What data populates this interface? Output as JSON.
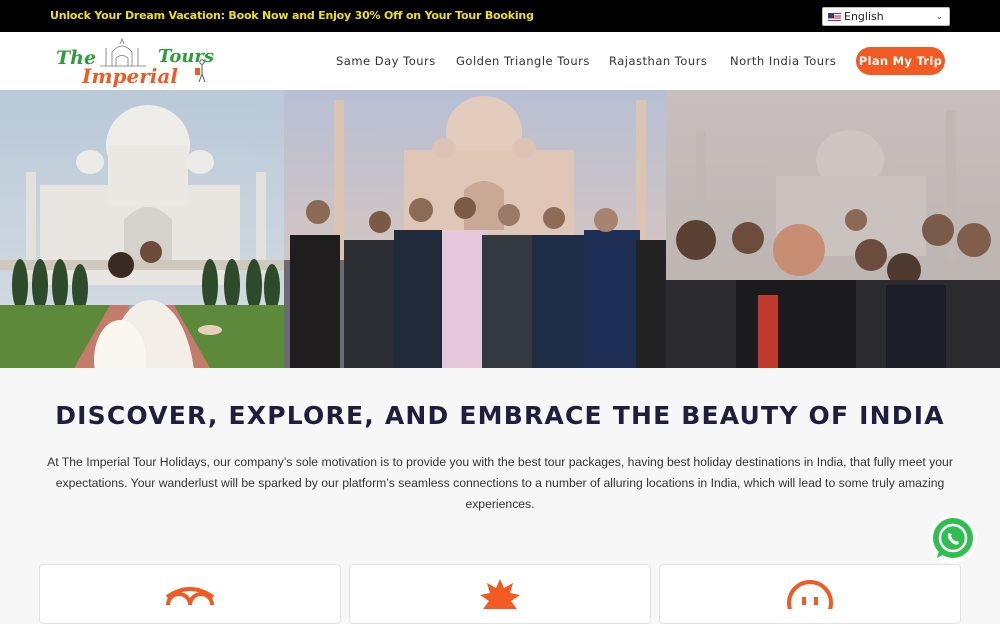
{
  "promo_bar": {
    "text": "Unlock Your Dream Vacation: Book Now and Enjoy 30% Off on Your Tour Booking"
  },
  "language": {
    "selected": "English",
    "flag": "us-flag-icon"
  },
  "logo": {
    "line1": "The",
    "line2": "Imperial",
    "line3": "Tours"
  },
  "nav": {
    "items": [
      {
        "label": "Same Day Tours"
      },
      {
        "label": "Golden Triangle Tours"
      },
      {
        "label": "Rajasthan Tours"
      },
      {
        "label": "North India Tours"
      }
    ],
    "cta": "Plan My Trip"
  },
  "colors": {
    "accent": "#f15a22",
    "promo_text": "#f2e20b",
    "heading": "#1f1f3d",
    "logo_green": "#2e9e3a"
  },
  "intro": {
    "headline": "DISCOVER, EXPLORE, AND EMBRACE THE BEAUTY OF INDIA",
    "body": "At The Imperial Tour Holidays, our company’s sole motivation is to provide you with the best tour packages, having best holiday destinations in India, that fully meet your expectations. Your wanderlust will be sparked by our platform’s seamless connections to a number of alluring locations in India, which will lead to some truly amazing experiences."
  },
  "cards": [
    {
      "icon": "tripadvisor-icon"
    },
    {
      "icon": "badge-icon"
    },
    {
      "icon": "smiley-icon"
    }
  ],
  "whatsapp": {
    "icon": "whatsapp-icon"
  }
}
